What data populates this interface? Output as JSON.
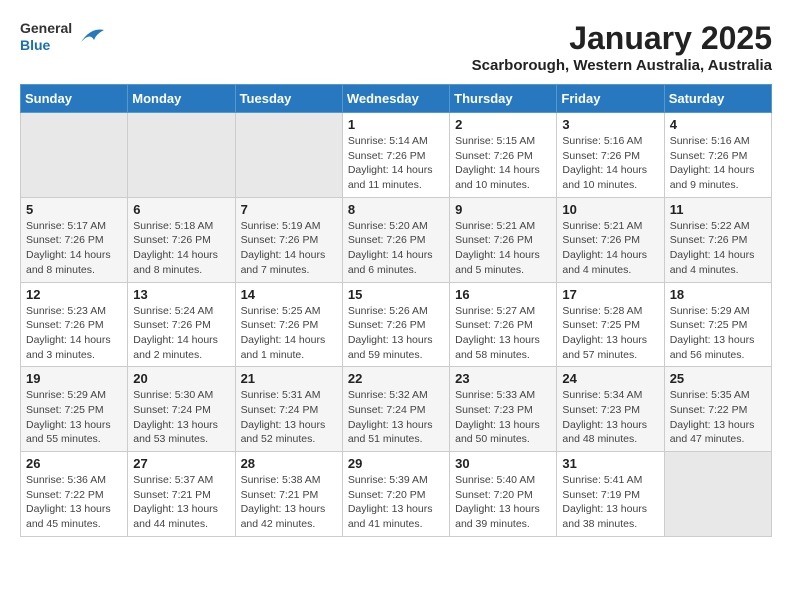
{
  "logo": {
    "general": "General",
    "blue": "Blue"
  },
  "title": "January 2025",
  "subtitle": "Scarborough, Western Australia, Australia",
  "weekdays": [
    "Sunday",
    "Monday",
    "Tuesday",
    "Wednesday",
    "Thursday",
    "Friday",
    "Saturday"
  ],
  "weeks": [
    [
      {
        "day": "",
        "info": ""
      },
      {
        "day": "",
        "info": ""
      },
      {
        "day": "",
        "info": ""
      },
      {
        "day": "1",
        "info": "Sunrise: 5:14 AM\nSunset: 7:26 PM\nDaylight: 14 hours\nand 11 minutes."
      },
      {
        "day": "2",
        "info": "Sunrise: 5:15 AM\nSunset: 7:26 PM\nDaylight: 14 hours\nand 10 minutes."
      },
      {
        "day": "3",
        "info": "Sunrise: 5:16 AM\nSunset: 7:26 PM\nDaylight: 14 hours\nand 10 minutes."
      },
      {
        "day": "4",
        "info": "Sunrise: 5:16 AM\nSunset: 7:26 PM\nDaylight: 14 hours\nand 9 minutes."
      }
    ],
    [
      {
        "day": "5",
        "info": "Sunrise: 5:17 AM\nSunset: 7:26 PM\nDaylight: 14 hours\nand 8 minutes."
      },
      {
        "day": "6",
        "info": "Sunrise: 5:18 AM\nSunset: 7:26 PM\nDaylight: 14 hours\nand 8 minutes."
      },
      {
        "day": "7",
        "info": "Sunrise: 5:19 AM\nSunset: 7:26 PM\nDaylight: 14 hours\nand 7 minutes."
      },
      {
        "day": "8",
        "info": "Sunrise: 5:20 AM\nSunset: 7:26 PM\nDaylight: 14 hours\nand 6 minutes."
      },
      {
        "day": "9",
        "info": "Sunrise: 5:21 AM\nSunset: 7:26 PM\nDaylight: 14 hours\nand 5 minutes."
      },
      {
        "day": "10",
        "info": "Sunrise: 5:21 AM\nSunset: 7:26 PM\nDaylight: 14 hours\nand 4 minutes."
      },
      {
        "day": "11",
        "info": "Sunrise: 5:22 AM\nSunset: 7:26 PM\nDaylight: 14 hours\nand 4 minutes."
      }
    ],
    [
      {
        "day": "12",
        "info": "Sunrise: 5:23 AM\nSunset: 7:26 PM\nDaylight: 14 hours\nand 3 minutes."
      },
      {
        "day": "13",
        "info": "Sunrise: 5:24 AM\nSunset: 7:26 PM\nDaylight: 14 hours\nand 2 minutes."
      },
      {
        "day": "14",
        "info": "Sunrise: 5:25 AM\nSunset: 7:26 PM\nDaylight: 14 hours\nand 1 minute."
      },
      {
        "day": "15",
        "info": "Sunrise: 5:26 AM\nSunset: 7:26 PM\nDaylight: 13 hours\nand 59 minutes."
      },
      {
        "day": "16",
        "info": "Sunrise: 5:27 AM\nSunset: 7:26 PM\nDaylight: 13 hours\nand 58 minutes."
      },
      {
        "day": "17",
        "info": "Sunrise: 5:28 AM\nSunset: 7:25 PM\nDaylight: 13 hours\nand 57 minutes."
      },
      {
        "day": "18",
        "info": "Sunrise: 5:29 AM\nSunset: 7:25 PM\nDaylight: 13 hours\nand 56 minutes."
      }
    ],
    [
      {
        "day": "19",
        "info": "Sunrise: 5:29 AM\nSunset: 7:25 PM\nDaylight: 13 hours\nand 55 minutes."
      },
      {
        "day": "20",
        "info": "Sunrise: 5:30 AM\nSunset: 7:24 PM\nDaylight: 13 hours\nand 53 minutes."
      },
      {
        "day": "21",
        "info": "Sunrise: 5:31 AM\nSunset: 7:24 PM\nDaylight: 13 hours\nand 52 minutes."
      },
      {
        "day": "22",
        "info": "Sunrise: 5:32 AM\nSunset: 7:24 PM\nDaylight: 13 hours\nand 51 minutes."
      },
      {
        "day": "23",
        "info": "Sunrise: 5:33 AM\nSunset: 7:23 PM\nDaylight: 13 hours\nand 50 minutes."
      },
      {
        "day": "24",
        "info": "Sunrise: 5:34 AM\nSunset: 7:23 PM\nDaylight: 13 hours\nand 48 minutes."
      },
      {
        "day": "25",
        "info": "Sunrise: 5:35 AM\nSunset: 7:22 PM\nDaylight: 13 hours\nand 47 minutes."
      }
    ],
    [
      {
        "day": "26",
        "info": "Sunrise: 5:36 AM\nSunset: 7:22 PM\nDaylight: 13 hours\nand 45 minutes."
      },
      {
        "day": "27",
        "info": "Sunrise: 5:37 AM\nSunset: 7:21 PM\nDaylight: 13 hours\nand 44 minutes."
      },
      {
        "day": "28",
        "info": "Sunrise: 5:38 AM\nSunset: 7:21 PM\nDaylight: 13 hours\nand 42 minutes."
      },
      {
        "day": "29",
        "info": "Sunrise: 5:39 AM\nSunset: 7:20 PM\nDaylight: 13 hours\nand 41 minutes."
      },
      {
        "day": "30",
        "info": "Sunrise: 5:40 AM\nSunset: 7:20 PM\nDaylight: 13 hours\nand 39 minutes."
      },
      {
        "day": "31",
        "info": "Sunrise: 5:41 AM\nSunset: 7:19 PM\nDaylight: 13 hours\nand 38 minutes."
      },
      {
        "day": "",
        "info": ""
      }
    ]
  ]
}
